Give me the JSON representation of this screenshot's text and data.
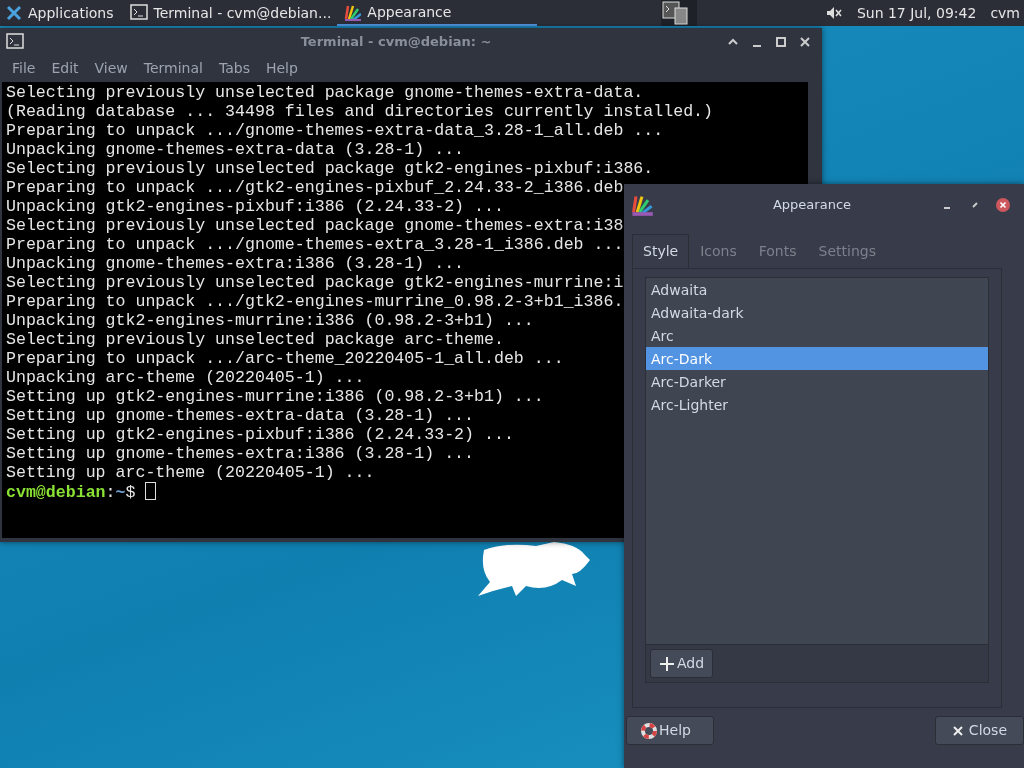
{
  "panel": {
    "applications": "Applications",
    "tasks": [
      {
        "label": "Terminal - cvm@debian...",
        "kind": "terminal",
        "selected": false
      },
      {
        "label": "Appearance",
        "kind": "appearance",
        "selected": true
      }
    ],
    "clock": "Sun 17 Jul, 09:42",
    "user": "cvm"
  },
  "terminal": {
    "title": "Terminal - cvm@debian: ~",
    "menu": [
      "File",
      "Edit",
      "View",
      "Terminal",
      "Tabs",
      "Help"
    ],
    "lines": [
      "Selecting previously unselected package gnome-themes-extra-data.",
      "(Reading database ... 34498 files and directories currently installed.)",
      "Preparing to unpack .../gnome-themes-extra-data_3.28-1_all.deb ...",
      "Unpacking gnome-themes-extra-data (3.28-1) ...",
      "Selecting previously unselected package gtk2-engines-pixbuf:i386.",
      "Preparing to unpack .../gtk2-engines-pixbuf_2.24.33-2_i386.deb",
      "Unpacking gtk2-engines-pixbuf:i386 (2.24.33-2) ...",
      "Selecting previously unselected package gnome-themes-extra:i38",
      "Preparing to unpack .../gnome-themes-extra_3.28-1_i386.deb ...",
      "Unpacking gnome-themes-extra:i386 (3.28-1) ...",
      "Selecting previously unselected package gtk2-engines-murrine:i",
      "Preparing to unpack .../gtk2-engines-murrine_0.98.2-3+b1_i386.",
      "Unpacking gtk2-engines-murrine:i386 (0.98.2-3+b1) ...",
      "Selecting previously unselected package arc-theme.",
      "Preparing to unpack .../arc-theme_20220405-1_all.deb ...",
      "Unpacking arc-theme (20220405-1) ...",
      "Setting up gtk2-engines-murrine:i386 (0.98.2-3+b1) ...",
      "Setting up gnome-themes-extra-data (3.28-1) ...",
      "Setting up gtk2-engines-pixbuf:i386 (2.24.33-2) ...",
      "Setting up gnome-themes-extra:i386 (3.28-1) ...",
      "Setting up arc-theme (20220405-1) ..."
    ],
    "prompt": {
      "user_host": "cvm@debian",
      "separator": ":",
      "path": "~",
      "symbol": "$"
    }
  },
  "appearance": {
    "title": "Appearance",
    "tabs": [
      {
        "label": "Style",
        "selected": true
      },
      {
        "label": "Icons",
        "selected": false
      },
      {
        "label": "Fonts",
        "selected": false
      },
      {
        "label": "Settings",
        "selected": false
      }
    ],
    "themes": [
      {
        "label": "Adwaita",
        "selected": false
      },
      {
        "label": "Adwaita-dark",
        "selected": false
      },
      {
        "label": "Arc",
        "selected": false
      },
      {
        "label": "Arc-Dark",
        "selected": true
      },
      {
        "label": "Arc-Darker",
        "selected": false
      },
      {
        "label": "Arc-Lighter",
        "selected": false
      }
    ],
    "add_button": "Add",
    "help_button": "Help",
    "close_button": "Close"
  }
}
